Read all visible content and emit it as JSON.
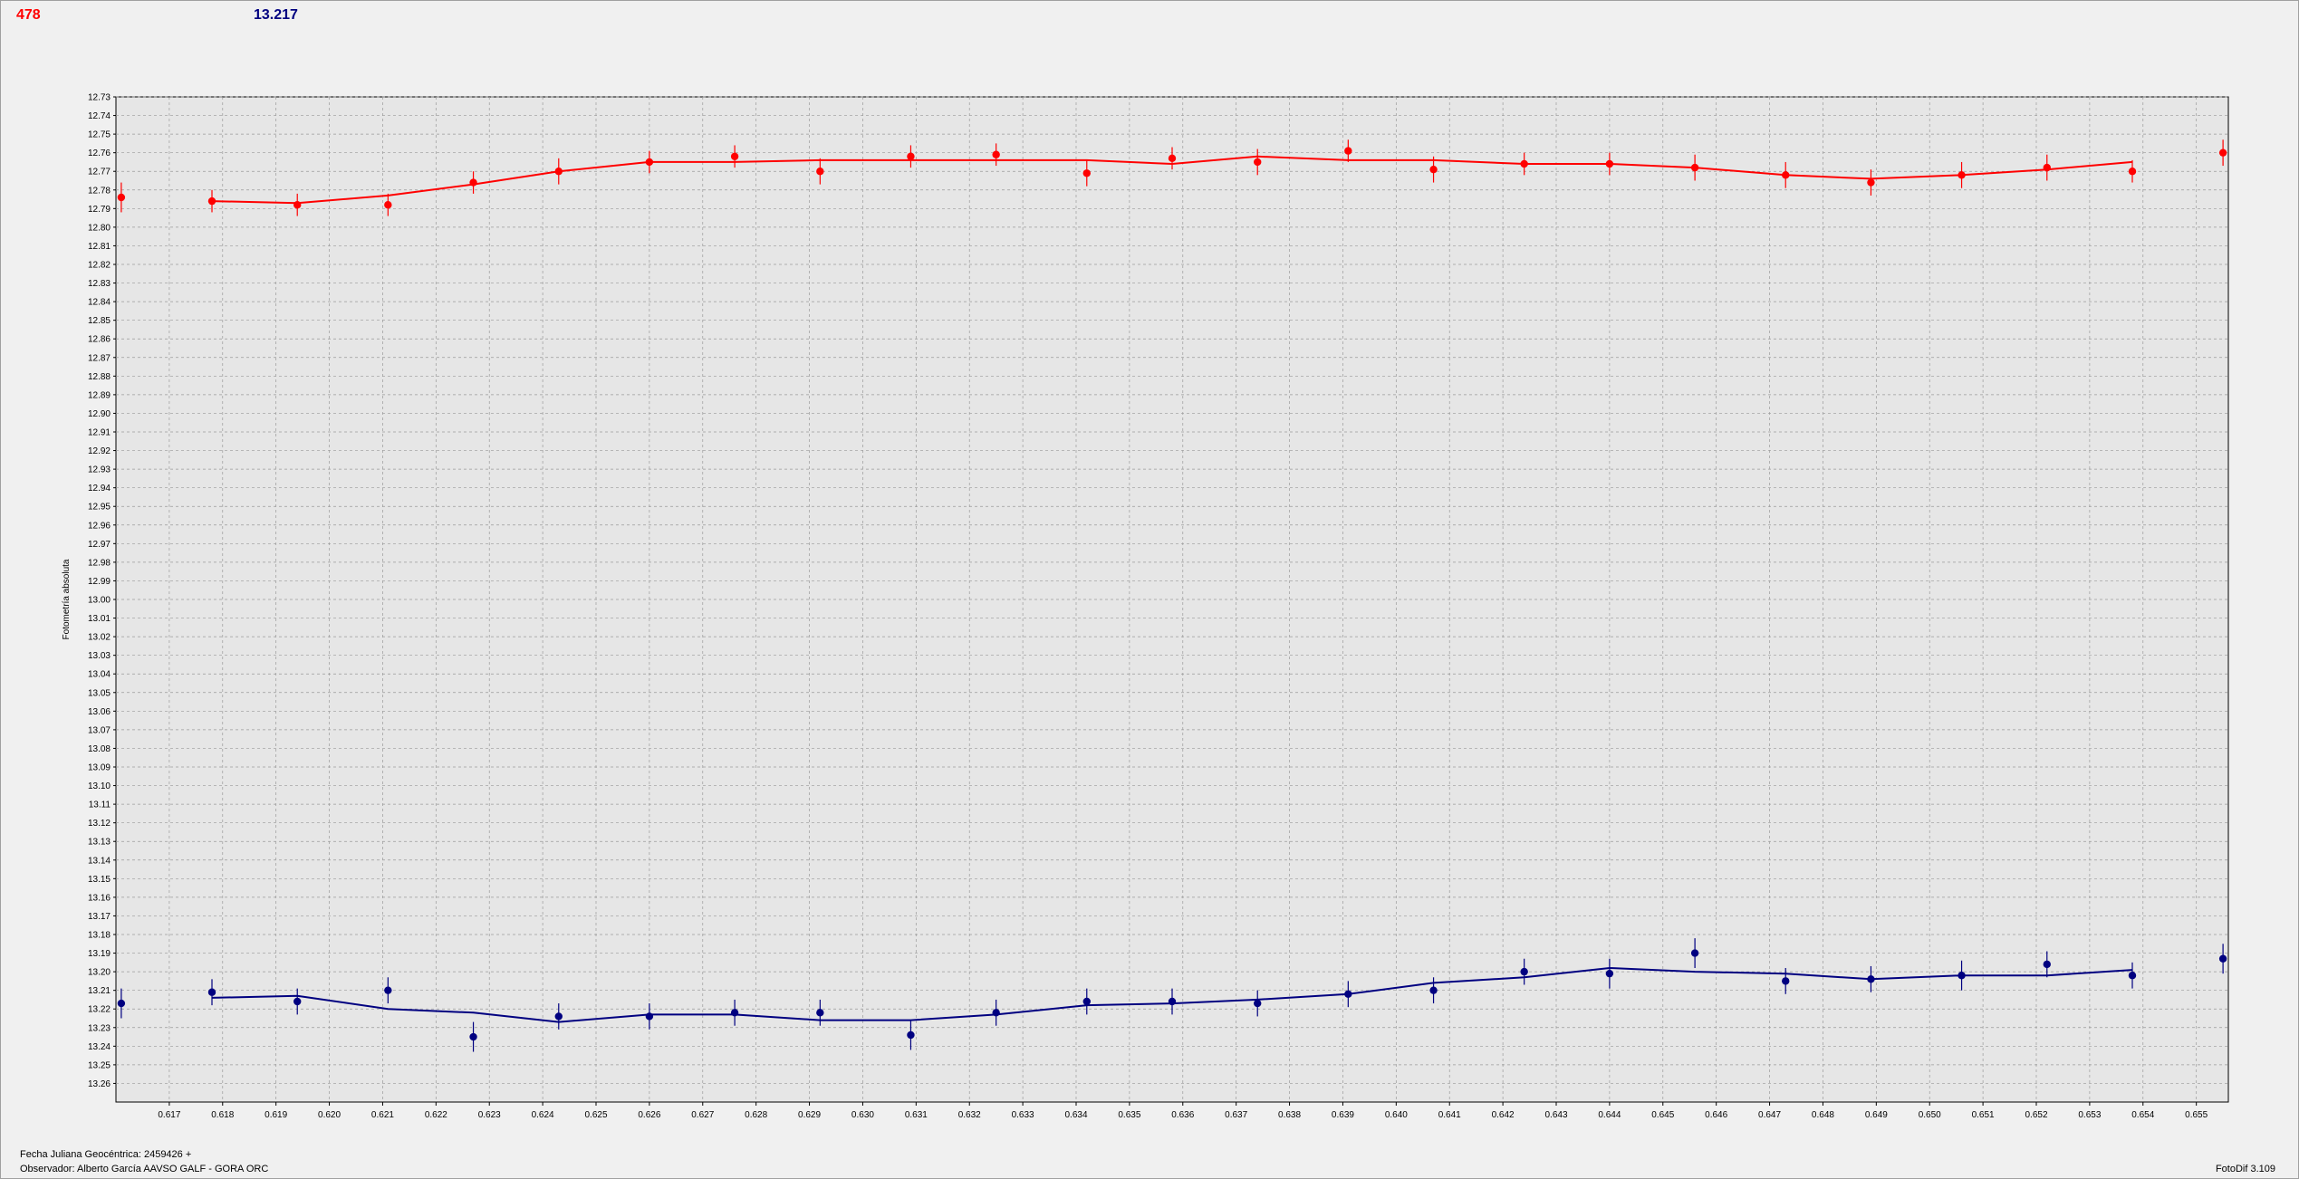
{
  "header": {
    "value_red": "478",
    "value_blue": "13.217"
  },
  "footer": {
    "line1": "Fecha Juliana Geocéntrica: 2459426 +",
    "line2": "Observador: Alberto García AAVSO GALF - GORA ORC",
    "version": "FotoDif 3.109"
  },
  "colors": {
    "series_red": "#ff0000",
    "series_blue": "#000080",
    "grid": "#9a9a9a",
    "plot_bg": "#e6e6e6"
  },
  "chart_data": {
    "type": "line",
    "title": "",
    "xlabel": "",
    "ylabel": "Fotometría absoluta",
    "xlim": [
      0.616,
      0.6556
    ],
    "ylim": [
      12.73,
      13.27
    ],
    "y_inverted": true,
    "grid": true,
    "x_ticks": [
      "0.617",
      "0.618",
      "0.619",
      "0.620",
      "0.621",
      "0.622",
      "0.623",
      "0.624",
      "0.625",
      "0.626",
      "0.627",
      "0.628",
      "0.629",
      "0.630",
      "0.631",
      "0.632",
      "0.633",
      "0.634",
      "0.635",
      "0.636",
      "0.637",
      "0.638",
      "0.639",
      "0.640",
      "0.641",
      "0.642",
      "0.643",
      "0.644",
      "0.645",
      "0.646",
      "0.647",
      "0.648",
      "0.649",
      "0.650",
      "0.651",
      "0.652",
      "0.653",
      "0.654",
      "0.655"
    ],
    "y_ticks": [
      "12.73",
      "12.74",
      "12.75",
      "12.76",
      "12.77",
      "12.78",
      "12.79",
      "12.80",
      "12.81",
      "12.82",
      "12.83",
      "12.84",
      "12.85",
      "12.86",
      "12.87",
      "12.88",
      "12.89",
      "12.90",
      "12.91",
      "12.92",
      "12.93",
      "12.94",
      "12.95",
      "12.96",
      "12.97",
      "12.98",
      "12.99",
      "13.00",
      "13.01",
      "13.02",
      "13.03",
      "13.04",
      "13.05",
      "13.06",
      "13.07",
      "13.08",
      "13.09",
      "13.10",
      "13.11",
      "13.12",
      "13.13",
      "13.14",
      "13.15",
      "13.16",
      "13.17",
      "13.18",
      "13.19",
      "13.20",
      "13.21",
      "13.22",
      "13.23",
      "13.24",
      "13.25",
      "13.26"
    ],
    "series": [
      {
        "color": "#ff0000",
        "points": [
          [
            0.6161,
            12.784,
            0.008
          ],
          [
            0.6178,
            12.786,
            0.006
          ],
          [
            0.6194,
            12.788,
            0.006
          ],
          [
            0.6211,
            12.788,
            0.006
          ],
          [
            0.6227,
            12.776,
            0.006
          ],
          [
            0.6243,
            12.77,
            0.007
          ],
          [
            0.626,
            12.765,
            0.006
          ],
          [
            0.6276,
            12.762,
            0.006
          ],
          [
            0.6292,
            12.77,
            0.007
          ],
          [
            0.6309,
            12.762,
            0.006
          ],
          [
            0.6325,
            12.761,
            0.006
          ],
          [
            0.6342,
            12.771,
            0.007
          ],
          [
            0.6358,
            12.763,
            0.006
          ],
          [
            0.6374,
            12.765,
            0.007
          ],
          [
            0.6391,
            12.759,
            0.006
          ],
          [
            0.6407,
            12.769,
            0.007
          ],
          [
            0.6424,
            12.766,
            0.006
          ],
          [
            0.644,
            12.766,
            0.006
          ],
          [
            0.6456,
            12.768,
            0.007
          ],
          [
            0.6473,
            12.772,
            0.007
          ],
          [
            0.6489,
            12.776,
            0.007
          ],
          [
            0.6506,
            12.772,
            0.007
          ],
          [
            0.6522,
            12.768,
            0.007
          ],
          [
            0.6538,
            12.77,
            0.006
          ],
          [
            0.6555,
            12.76,
            0.007
          ]
        ],
        "fit": [
          [
            0.6178,
            12.786
          ],
          [
            0.6194,
            12.787
          ],
          [
            0.6211,
            12.783
          ],
          [
            0.6227,
            12.777
          ],
          [
            0.6243,
            12.77
          ],
          [
            0.626,
            12.765
          ],
          [
            0.6276,
            12.765
          ],
          [
            0.6292,
            12.764
          ],
          [
            0.6309,
            12.764
          ],
          [
            0.6325,
            12.764
          ],
          [
            0.6342,
            12.764
          ],
          [
            0.6358,
            12.766
          ],
          [
            0.6374,
            12.762
          ],
          [
            0.6391,
            12.764
          ],
          [
            0.6407,
            12.764
          ],
          [
            0.6424,
            12.766
          ],
          [
            0.644,
            12.766
          ],
          [
            0.6456,
            12.768
          ],
          [
            0.6473,
            12.772
          ],
          [
            0.6489,
            12.774
          ],
          [
            0.6506,
            12.772
          ],
          [
            0.6522,
            12.769
          ],
          [
            0.6538,
            12.765
          ]
        ]
      },
      {
        "color": "#000080",
        "points": [
          [
            0.6161,
            13.217,
            0.008
          ],
          [
            0.6178,
            13.211,
            0.007
          ],
          [
            0.6194,
            13.216,
            0.007
          ],
          [
            0.6211,
            13.21,
            0.007
          ],
          [
            0.6227,
            13.235,
            0.008
          ],
          [
            0.6243,
            13.224,
            0.007
          ],
          [
            0.626,
            13.224,
            0.007
          ],
          [
            0.6276,
            13.222,
            0.007
          ],
          [
            0.6292,
            13.222,
            0.007
          ],
          [
            0.6309,
            13.234,
            0.008
          ],
          [
            0.6325,
            13.222,
            0.007
          ],
          [
            0.6342,
            13.216,
            0.007
          ],
          [
            0.6358,
            13.216,
            0.007
          ],
          [
            0.6374,
            13.217,
            0.007
          ],
          [
            0.6391,
            13.212,
            0.007
          ],
          [
            0.6407,
            13.21,
            0.007
          ],
          [
            0.6424,
            13.2,
            0.007
          ],
          [
            0.644,
            13.201,
            0.008
          ],
          [
            0.6456,
            13.19,
            0.008
          ],
          [
            0.6473,
            13.205,
            0.007
          ],
          [
            0.6489,
            13.204,
            0.007
          ],
          [
            0.6506,
            13.202,
            0.008
          ],
          [
            0.6522,
            13.196,
            0.007
          ],
          [
            0.6538,
            13.202,
            0.007
          ],
          [
            0.6555,
            13.193,
            0.008
          ]
        ],
        "fit": [
          [
            0.6178,
            13.214
          ],
          [
            0.6194,
            13.213
          ],
          [
            0.6211,
            13.22
          ],
          [
            0.6227,
            13.222
          ],
          [
            0.6243,
            13.227
          ],
          [
            0.626,
            13.223
          ],
          [
            0.6276,
            13.223
          ],
          [
            0.6292,
            13.226
          ],
          [
            0.6309,
            13.226
          ],
          [
            0.6325,
            13.223
          ],
          [
            0.6342,
            13.218
          ],
          [
            0.6358,
            13.217
          ],
          [
            0.6374,
            13.215
          ],
          [
            0.6391,
            13.212
          ],
          [
            0.6407,
            13.206
          ],
          [
            0.6424,
            13.203
          ],
          [
            0.644,
            13.198
          ],
          [
            0.6456,
            13.2
          ],
          [
            0.6473,
            13.201
          ],
          [
            0.6489,
            13.204
          ],
          [
            0.6506,
            13.202
          ],
          [
            0.6522,
            13.202
          ],
          [
            0.6538,
            13.199
          ]
        ]
      }
    ]
  }
}
